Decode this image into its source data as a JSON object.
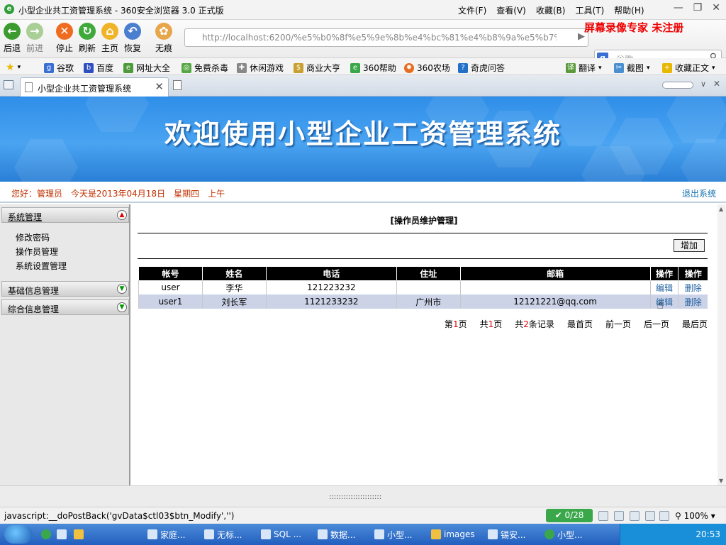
{
  "window": {
    "title": "小型企业共工资管理系统 - 360安全浏览器 3.0 正式版",
    "menus": [
      "文件(F)",
      "查看(V)",
      "收藏(B)",
      "工具(T)",
      "帮助(H)"
    ]
  },
  "nav": {
    "back": "后退",
    "forward": "前进",
    "stop": "停止",
    "refresh": "刷新",
    "home": "主页",
    "restore": "恢复",
    "private": "无痕",
    "url": "http://localhost:6200/%e5%b0%8f%e5%9e%8b%e4%bc%81%e4%b8%9a%e5%b7%",
    "search_placeholder": "谷歌",
    "watermark": "屏幕录像专家 未注册"
  },
  "favorites": [
    "谷歌",
    "百度",
    "网址大全",
    "免费杀毒",
    "休闲游戏",
    "商业大亨",
    "360帮助",
    "360农场",
    "奇虎问答"
  ],
  "favorites_right": [
    "翻译",
    "截图",
    "收藏正文"
  ],
  "tab": {
    "title": "小型企业共工资管理系统"
  },
  "banner": {
    "headline": "欢迎使用小型企业工资管理系统"
  },
  "infobar": {
    "greeting": "您好：管理员　今天是2013年04月18日　星期四　上午",
    "logout": "退出系统"
  },
  "sidebar": {
    "sections": [
      {
        "label": "系统管理",
        "expanded": true
      },
      {
        "label": "基础信息管理",
        "expanded": false
      },
      {
        "label": "综合信息管理",
        "expanded": false
      }
    ],
    "sub_items": [
      "修改密码",
      "操作员管理",
      "系统设置管理"
    ]
  },
  "main": {
    "title": "[操作员维护管理]",
    "add_button": "增加",
    "columns": [
      "帐号",
      "姓名",
      "电话",
      "住址",
      "邮箱",
      "操作",
      "操作"
    ],
    "rows": [
      {
        "account": "user",
        "name": "李华",
        "phone": "121223232",
        "address": "",
        "email": "",
        "edit": "编辑",
        "delete": "删除"
      },
      {
        "account": "user1",
        "name": "刘长军",
        "phone": "1121233232",
        "address": "广州市",
        "email": "12121221@qq.com",
        "edit": "编辑",
        "delete": "删除"
      }
    ],
    "pager": {
      "page_prefix": "第",
      "page_num": "1",
      "page_suffix": "页",
      "total_prefix": "共",
      "total_num": "1",
      "total_suffix": "页",
      "rec_prefix": "共",
      "rec_num": "2",
      "rec_suffix": "条记录",
      "first": "最首页",
      "prev": "前一页",
      "next": "后一页",
      "last": "最后页"
    }
  },
  "bottom": {
    "grip": "::::::::::::::::::::::"
  },
  "status": {
    "text": "javascript:__doPostBack('gvData$ctl03$btn_Modify','')",
    "badge": "0/28",
    "zoom": "100%"
  },
  "taskbar": {
    "tasks": [
      "家庭...",
      "无标...",
      "SQL ...",
      "数据...",
      "小型...",
      "images",
      "锡安...",
      "小型..."
    ],
    "clock": "20:53"
  },
  "colors": {
    "banner": "#3a98ee",
    "greeting": "#c03000",
    "header_row": "#000000",
    "alt_row": "#ccd3e7",
    "link": "#2060a0"
  }
}
